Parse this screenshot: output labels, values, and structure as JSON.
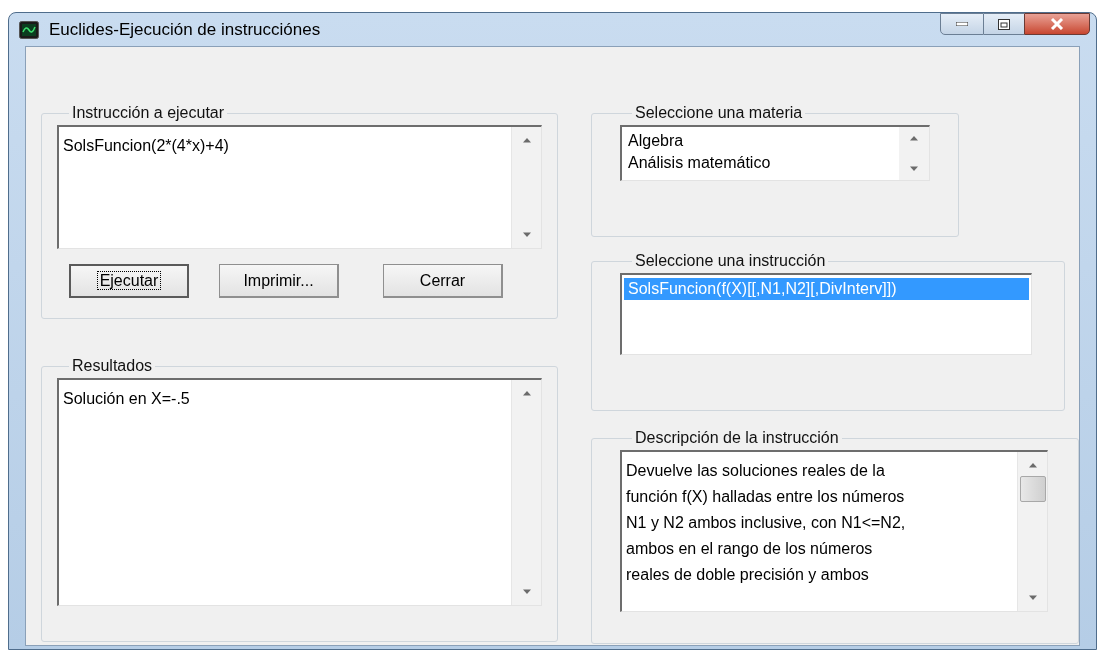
{
  "window": {
    "title": "Euclides-Ejecución de instrucciónes"
  },
  "instruction_group": {
    "label": "Instrucción a ejecutar",
    "value": "SolsFuncion(2*(4*x)+4)"
  },
  "buttons": [
    {
      "label": "Ejecutar",
      "focused": true
    },
    {
      "label": "Imprimir...",
      "focused": false
    },
    {
      "label": "Cerrar",
      "focused": false
    }
  ],
  "results_group": {
    "label": "Resultados",
    "value": "Solución en X=-.5"
  },
  "subject_group": {
    "label": "Seleccione una materia",
    "items": [
      {
        "label": "Algebra",
        "selected": false
      },
      {
        "label": "Análisis matemático",
        "selected": false
      }
    ]
  },
  "instruction_list_group": {
    "label": "Seleccione una instrucción",
    "items": [
      {
        "label": "SolsFuncion(f(X)[[,N1,N2][,DivInterv]])",
        "selected": true
      }
    ]
  },
  "description_group": {
    "label": "Descripción de la instrucción",
    "text": "Devuelve las soluciones reales de la\nfunción f(X) halladas entre los números\nN1 y N2 ambos inclusive, con N1<=N2,\nambos en el rango de los números\nreales de doble precisión y ambos"
  }
}
